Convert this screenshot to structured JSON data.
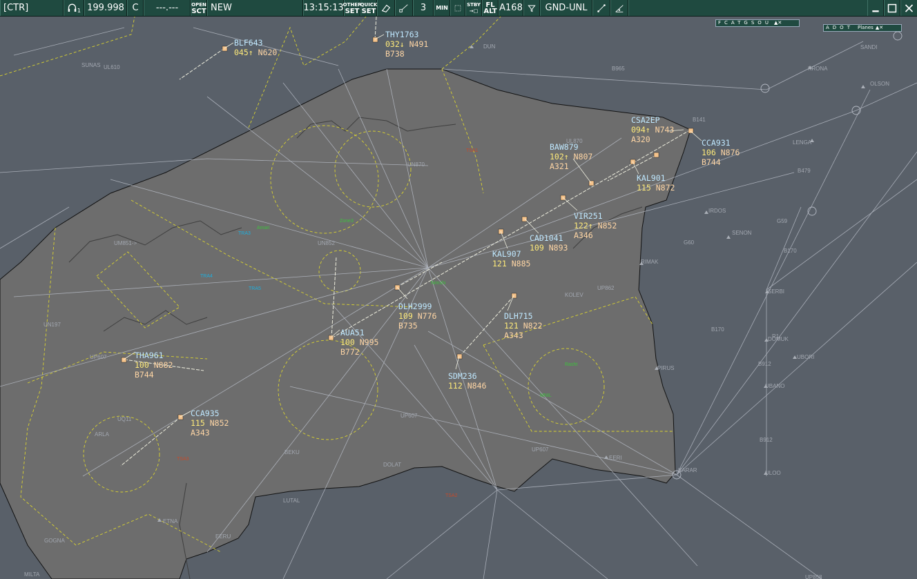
{
  "toolbar": {
    "position": "[CTR]",
    "freq_channel": "1",
    "frequency": "199.998",
    "mode": "C",
    "code_placeholder": "---.---",
    "open_sct_top": "OPEN",
    "open_sct_bottom": "SCT",
    "sector_name": "NEW",
    "clock": "13:15:13",
    "other_set_top": "OTHER",
    "other_set_bottom": "SET",
    "quick_set_top": "QUICK",
    "quick_set_bottom": "SET",
    "count": "3",
    "min": "MIN",
    "stby_top": "STBY",
    "stby_bottom": "",
    "fl_top": "FL",
    "fl_bottom": "ALT",
    "altitude": "A168",
    "filter_range": "GND-UNL"
  },
  "panels": {
    "fcat": {
      "label": "FCATGSOU",
      "close": "▲✕"
    },
    "adot": {
      "label": "ADOT",
      "sub": "Planes",
      "close": "▲✕"
    }
  },
  "aircraft": [
    {
      "callsign": "BLF643",
      "level": "045↑",
      "next": "N620",
      "type": ""
    },
    {
      "callsign": "THY1763",
      "level": "032↓",
      "next": "N491",
      "type": "B738"
    },
    {
      "callsign": "CSA2EP",
      "level": "094↑",
      "next": "N743",
      "type": "A320"
    },
    {
      "callsign": "CCA931",
      "level": "106",
      "next": "N876",
      "type": "B744"
    },
    {
      "callsign": "BAW879",
      "level": "102↑",
      "next": "N807",
      "type": "A321"
    },
    {
      "callsign": "KAL901",
      "level": "115",
      "next": "N872",
      "type": ""
    },
    {
      "callsign": "VIR251",
      "level": "122↑",
      "next": "N852",
      "type": "A346"
    },
    {
      "callsign": "CAD1041",
      "level": "109",
      "next": "N893",
      "type": ""
    },
    {
      "callsign": "KAL907",
      "level": "121",
      "next": "N885",
      "type": ""
    },
    {
      "callsign": "DLH2999",
      "level": "109",
      "next": "N776",
      "type": "B735"
    },
    {
      "callsign": "DLH715",
      "level": "121",
      "next": "N822",
      "type": "A343"
    },
    {
      "callsign": "AUA51",
      "level": "100",
      "next": "N995",
      "type": "B772"
    },
    {
      "callsign": "THA961",
      "level": "100",
      "next": "N882",
      "type": "B744"
    },
    {
      "callsign": "SDM236",
      "level": "112",
      "next": "N846",
      "type": ""
    },
    {
      "callsign": "CCA935",
      "level": "115",
      "next": "N852",
      "type": "A343"
    }
  ],
  "waypoints": [
    "SUNAS",
    "B965",
    "KRONA",
    "SANDI",
    "OLSON",
    "LENGA",
    "B479",
    "IRDOS",
    "SENON",
    "G59",
    "B170",
    "G60",
    "SERBI",
    "R1",
    "DOMUK",
    "UBORI",
    "B912",
    "UBANO",
    "ULOO",
    "UP863",
    "UM851",
    "UN197",
    "UQ11",
    "UP607",
    "UL738",
    "UM864",
    "UM869",
    "UN85",
    "UL855",
    "UQ71",
    "UP975",
    "UL870",
    "TSA1",
    "TSA2",
    "TSA3",
    "DUN",
    "UN862",
    "UP862",
    "KOLEV",
    "RIMAK",
    "PIRUS",
    "EERI",
    "ETNA",
    "EERU",
    "BEKU",
    "LUTAL",
    "GOGNA",
    "MILTA",
    "ARLA",
    "KARAR",
    "DOLAT",
    "CHASE",
    "HUNAS",
    "MOPAL",
    "RESMO"
  ],
  "colors": {
    "sea": "#596069",
    "land": "#6c6c6c",
    "toolbar": "#1f4a40",
    "callsign": "#bfe8ff",
    "level": "#ffeb7a",
    "info": "#ffd6a5",
    "sector_line": "#dbd42f",
    "route_line": "#b7bcc6"
  }
}
